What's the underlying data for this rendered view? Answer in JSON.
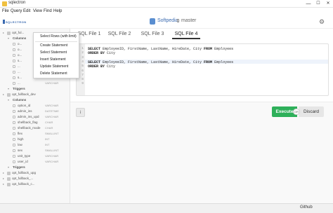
{
  "window": {
    "title": "sqlectron",
    "minimize": "—",
    "maximize": "☐",
    "close": "✕"
  },
  "menu": [
    "File",
    "Query",
    "Edit",
    "View",
    "Find",
    "Help"
  ],
  "header": {
    "logo": "SQLECTRON",
    "db_name": "Softpedia",
    "branch": "master",
    "settings_glyph": "⚙"
  },
  "tabs": [
    "SQL File 1",
    "SQL File 2",
    "SQL File 3",
    "SQL File 4"
  ],
  "active_tab": "SQL File 4",
  "context_menu": [
    "Select Rows (with limit)",
    "Create Statement",
    "Select Statement",
    "Insert Statement",
    "Update Statement",
    "Delete Statement"
  ],
  "sidebar": [
    {
      "kind": "table",
      "name": "opt_ful...",
      "indent": 0
    },
    {
      "kind": "group",
      "name": "Columns",
      "indent": 1
    },
    {
      "kind": "column",
      "name": "o...",
      "type": "",
      "indent": 2
    },
    {
      "kind": "column",
      "name": "o...",
      "type": "",
      "indent": 2
    },
    {
      "kind": "column",
      "name": "o...",
      "type": "",
      "indent": 2
    },
    {
      "kind": "column",
      "name": "s...",
      "type": "",
      "indent": 2
    },
    {
      "kind": "column",
      "name": "...",
      "type": "",
      "indent": 2
    },
    {
      "kind": "column",
      "name": "...",
      "type": "",
      "indent": 2
    },
    {
      "kind": "column",
      "name": "s...",
      "type": "SMALLINT",
      "indent": 2
    },
    {
      "kind": "column",
      "name": "...",
      "type": "VARCHAR",
      "indent": 2
    },
    {
      "kind": "group",
      "name": "Triggers",
      "indent": 1
    },
    {
      "kind": "table",
      "name": "opt_fullback_dev",
      "indent": 0
    },
    {
      "kind": "group",
      "name": "Columns",
      "indent": 1
    },
    {
      "kind": "column",
      "name": "option_id",
      "type": "VARCHAR",
      "indent": 2
    },
    {
      "kind": "column",
      "name": "admin_ins",
      "type": "DATETIME",
      "indent": 2
    },
    {
      "kind": "column",
      "name": "admin_ins_upd",
      "type": "VARCHAR",
      "indent": 2
    },
    {
      "kind": "column",
      "name": "shellback_flag",
      "type": "CHAR",
      "indent": 2
    },
    {
      "kind": "column",
      "name": "shellback_mode",
      "type": "CHAR",
      "indent": 2
    },
    {
      "kind": "column",
      "name": "flex",
      "type": "SMALLINT",
      "indent": 2
    },
    {
      "kind": "column",
      "name": "high",
      "type": "INT",
      "indent": 2
    },
    {
      "kind": "column",
      "name": "low",
      "type": "INT",
      "indent": 2
    },
    {
      "kind": "column",
      "name": "sex",
      "type": "SMALLINT",
      "indent": 2
    },
    {
      "kind": "column",
      "name": "unit_type",
      "type": "VARCHAR",
      "indent": 2
    },
    {
      "kind": "column",
      "name": "user_id",
      "type": "VARCHAR",
      "indent": 2
    },
    {
      "kind": "group",
      "name": "Triggers",
      "indent": 1
    },
    {
      "kind": "table",
      "name": "opt_fullback_upg",
      "indent": 0
    },
    {
      "kind": "table",
      "name": "opt_fullback_...",
      "indent": 0
    },
    {
      "kind": "table",
      "name": "opt_fullback_c...",
      "indent": 0
    }
  ],
  "editor": {
    "lines": [
      {
        "num": "1",
        "parts": [
          [
            "kw",
            "SELECT"
          ],
          [
            "",
            "EmployeeID, FirstName, LastName, HireDate, City "
          ],
          [
            "kw",
            "FROM"
          ],
          [
            "",
            "Employees"
          ]
        ]
      },
      {
        "num": "2",
        "parts": [
          [
            "kw",
            "ORDER BY"
          ],
          [
            "",
            "City"
          ]
        ]
      },
      {
        "num": "3",
        "parts": []
      },
      {
        "num": "4",
        "parts": [
          [
            "kw",
            "SELECT"
          ],
          [
            "",
            "EmployeeID, FirstName, LastName, HireDate, City "
          ],
          [
            "kw",
            "FROM"
          ],
          [
            "",
            "Employees"
          ]
        ]
      },
      {
        "num": "5",
        "parts": [
          [
            "kw",
            "ORDER BY"
          ],
          [
            "",
            "City"
          ]
        ]
      },
      {
        "num": "6",
        "parts": []
      },
      {
        "num": "7",
        "parts": []
      },
      {
        "num": "8",
        "parts": []
      },
      {
        "num": "9",
        "parts": []
      }
    ]
  },
  "actions": {
    "info": "i",
    "execute": "Execute",
    "or": "OR",
    "discard": "Discard"
  },
  "status": {
    "github": "Github"
  }
}
